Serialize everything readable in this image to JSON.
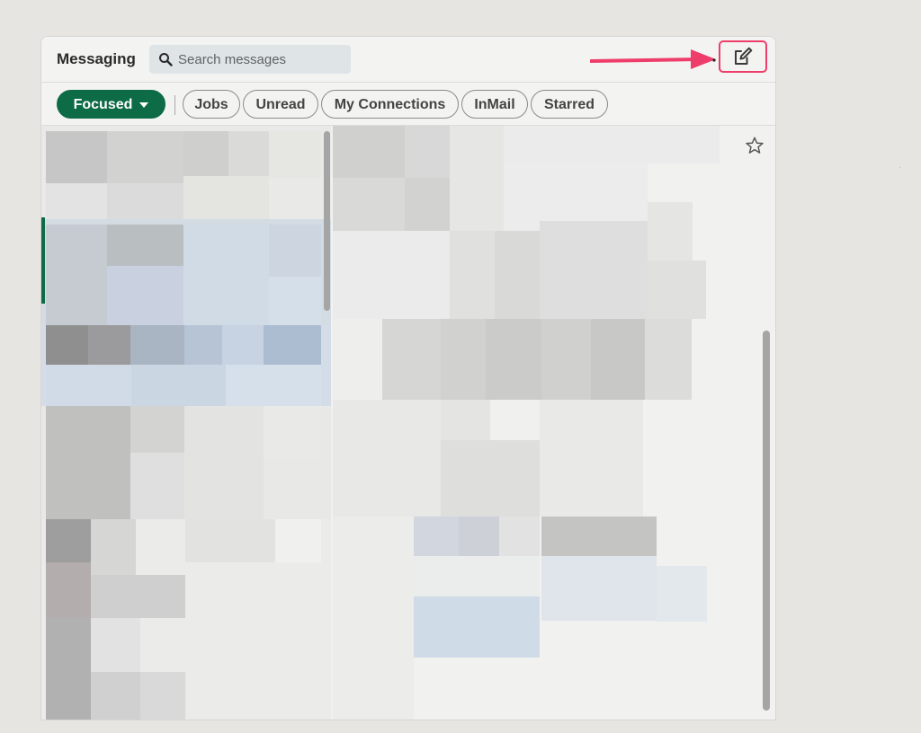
{
  "header": {
    "title": "Messaging",
    "search_placeholder": "Search messages"
  },
  "filters": [
    {
      "label": "Focused",
      "active": true
    },
    {
      "label": "Jobs",
      "active": false
    },
    {
      "label": "Unread",
      "active": false
    },
    {
      "label": "My Connections",
      "active": false
    },
    {
      "label": "InMail",
      "active": false
    },
    {
      "label": "Starred",
      "active": false
    }
  ],
  "icons": {
    "search": "search-icon",
    "compose": "compose-icon",
    "star": "star-icon",
    "caret": "caret-down-icon",
    "arrow": "arrow-right-icon"
  },
  "colors": {
    "accent": "#0d6b46",
    "highlight": "#ee3e6a"
  }
}
